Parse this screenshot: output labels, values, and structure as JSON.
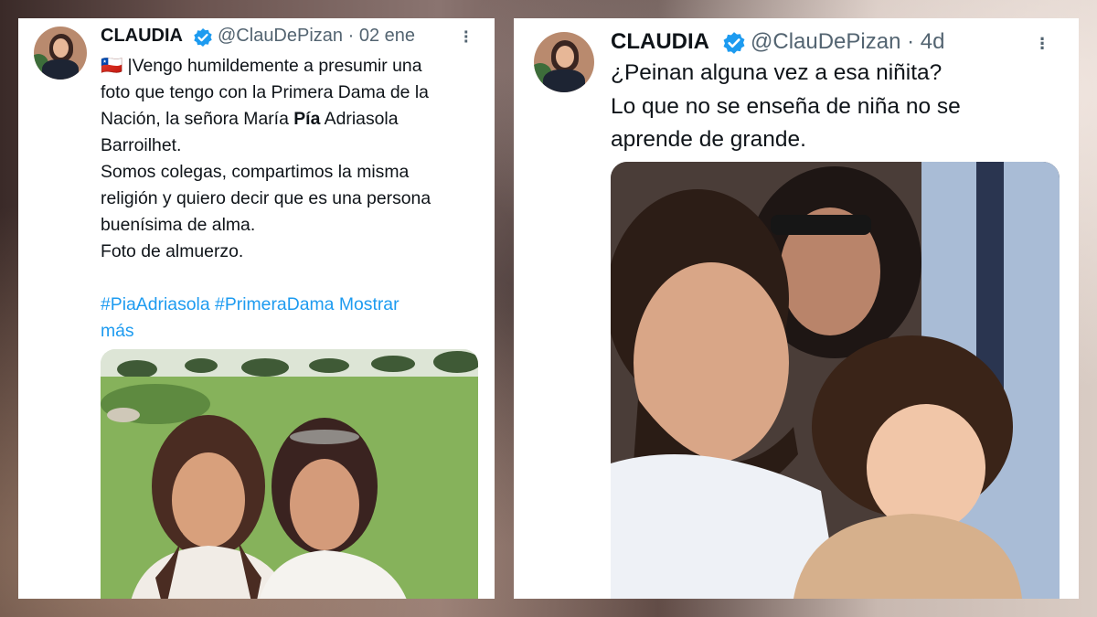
{
  "tweets": [
    {
      "display_name": "CLAUDIA",
      "handle": "@ClauDePizan",
      "separator": "·",
      "time": "02 ene",
      "flag": "🇨🇱",
      "lines": [
        "|Vengo humildemente a presumir una",
        "foto que tengo con la Primera Dama de la",
        "Nación, la señora María ",
        "Pía",
        " Adriasola",
        "Barroilhet.",
        "Somos colegas, compartimos la misma",
        "religión y quiero decir que es una persona",
        "buenísima de alma.",
        "Foto de almuerzo."
      ],
      "hashtags": [
        "#PiaAdriasola",
        "#PrimeraDama"
      ],
      "show_more": "Mostrar",
      "show_more_2": "más",
      "image_label": "two-women-golf-course-photo"
    },
    {
      "display_name": "CLAUDIA",
      "handle": "@ClauDePizan",
      "separator": "·",
      "time": "4d",
      "lines": [
        "¿Peinan alguna vez a esa niñita?",
        "Lo que no se enseña de niña no se",
        "aprende de grande."
      ],
      "image_label": "bearded-man-holding-baby-photo"
    }
  ],
  "colors": {
    "verified": "#1d9bf0",
    "link": "#1d9bf0",
    "text": "#0f1419",
    "muted": "#536471"
  },
  "icons": [
    "verified-badge-icon",
    "more-options-icon",
    "chile-flag-icon"
  ]
}
